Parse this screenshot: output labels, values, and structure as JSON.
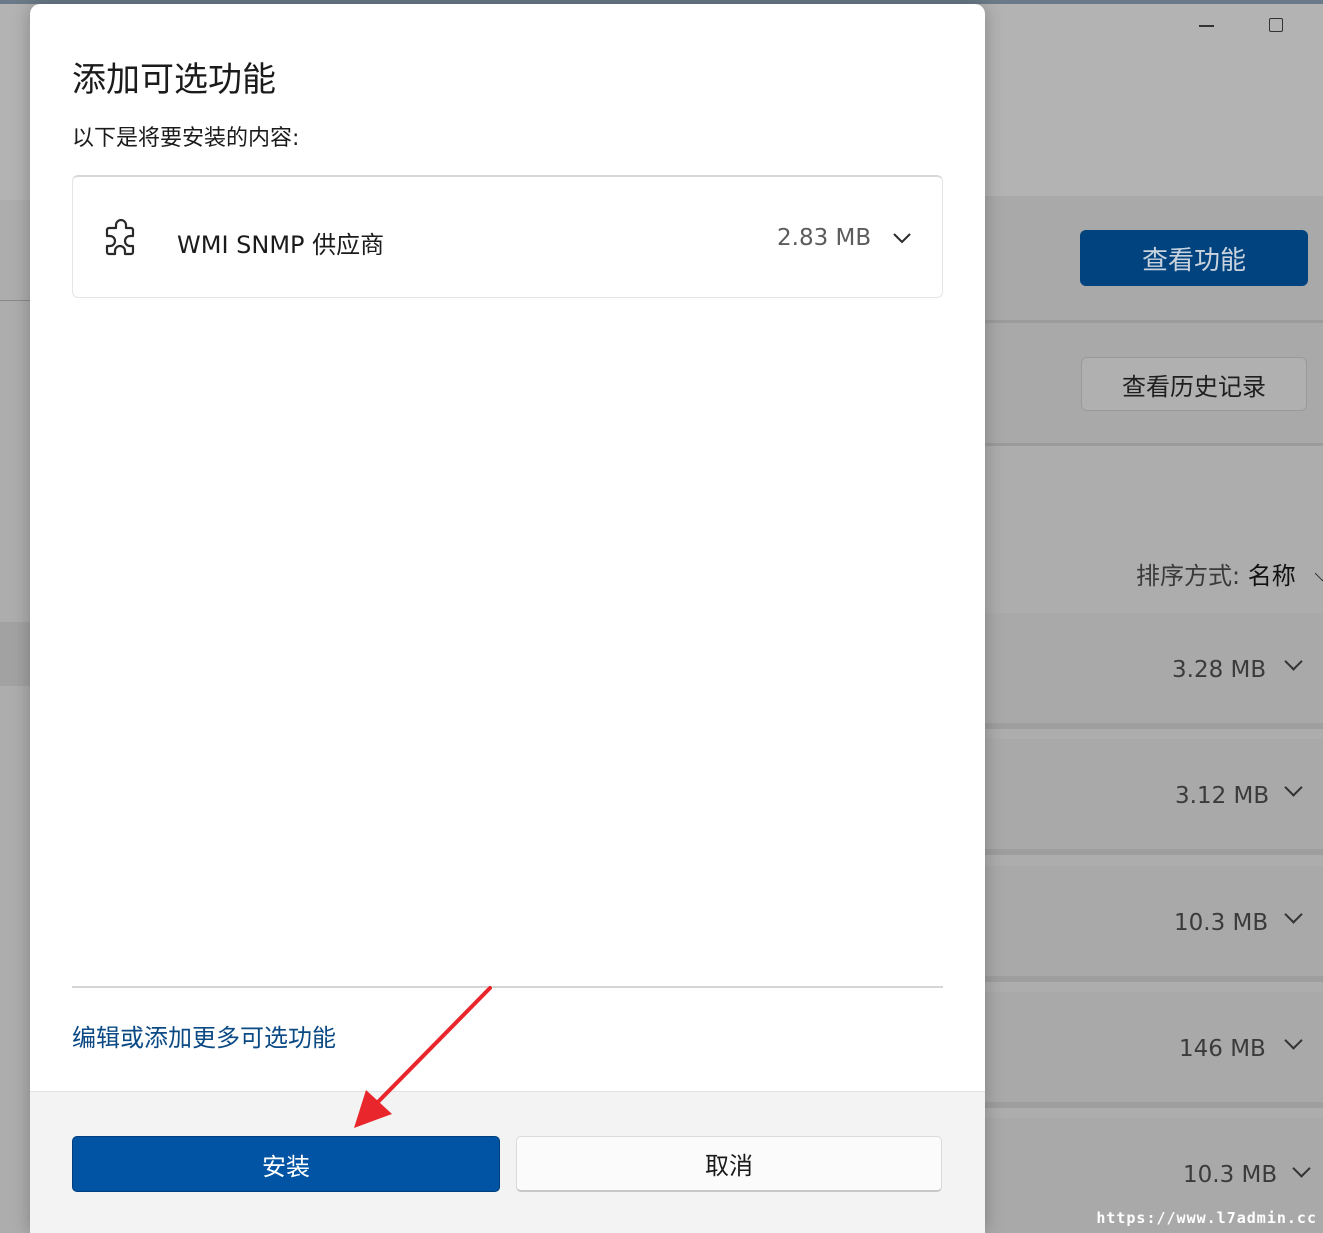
{
  "dialog": {
    "title": "添加可选功能",
    "subtitle": "以下是将要安装的内容:",
    "features": [
      {
        "name": "WMI SNMP 供应商",
        "size": "2.83 MB",
        "icon": "puzzle-icon"
      }
    ],
    "more_link": "编辑或添加更多可选功能",
    "install_label": "安装",
    "cancel_label": "取消"
  },
  "background": {
    "view_features_label": "查看功能",
    "view_history_label": "查看历史记录",
    "sort_label": "排序方式:",
    "sort_value": "名称",
    "installed_sizes": [
      "3.28 MB",
      "3.12 MB",
      "10.3 MB",
      "146 MB",
      "10.3 MB"
    ]
  },
  "watermark": "https://www.l7admin.cc",
  "colors": {
    "accent": "#0054a3",
    "link": "#0b4a85",
    "annotation_arrow": "#e8262b"
  }
}
